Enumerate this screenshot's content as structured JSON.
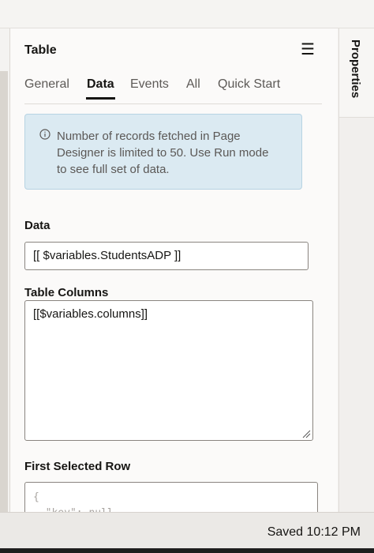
{
  "panel": {
    "title": "Table",
    "menu_icon": "hamburger-menu-icon"
  },
  "tabs": [
    {
      "label": "General",
      "active": false
    },
    {
      "label": "Data",
      "active": true
    },
    {
      "label": "Events",
      "active": false
    },
    {
      "label": "All",
      "active": false
    },
    {
      "label": "Quick Start",
      "active": false
    }
  ],
  "notice": {
    "icon": "info-icon",
    "lines": [
      "Number of records fetched in Page",
      "Designer is limited to 50. Use Run mode",
      "to see full set of data."
    ]
  },
  "fields": {
    "data_label": "Data",
    "data_value": "[[ $variables.StudentsADP ]]",
    "columns_label": "Table Columns",
    "columns_value": "[[$variables.columns]]",
    "first_row_label": "First Selected Row",
    "first_row_line1": "{",
    "first_row_line2": "  \"key\": null"
  },
  "right_rail": {
    "properties_tab": "Properties"
  },
  "status": {
    "saved": "Saved 10:12 PM"
  },
  "colors": {
    "accent_tab": "#161513",
    "notice_bg": "#dbeaf2",
    "notice_border": "#b7d3e3"
  }
}
